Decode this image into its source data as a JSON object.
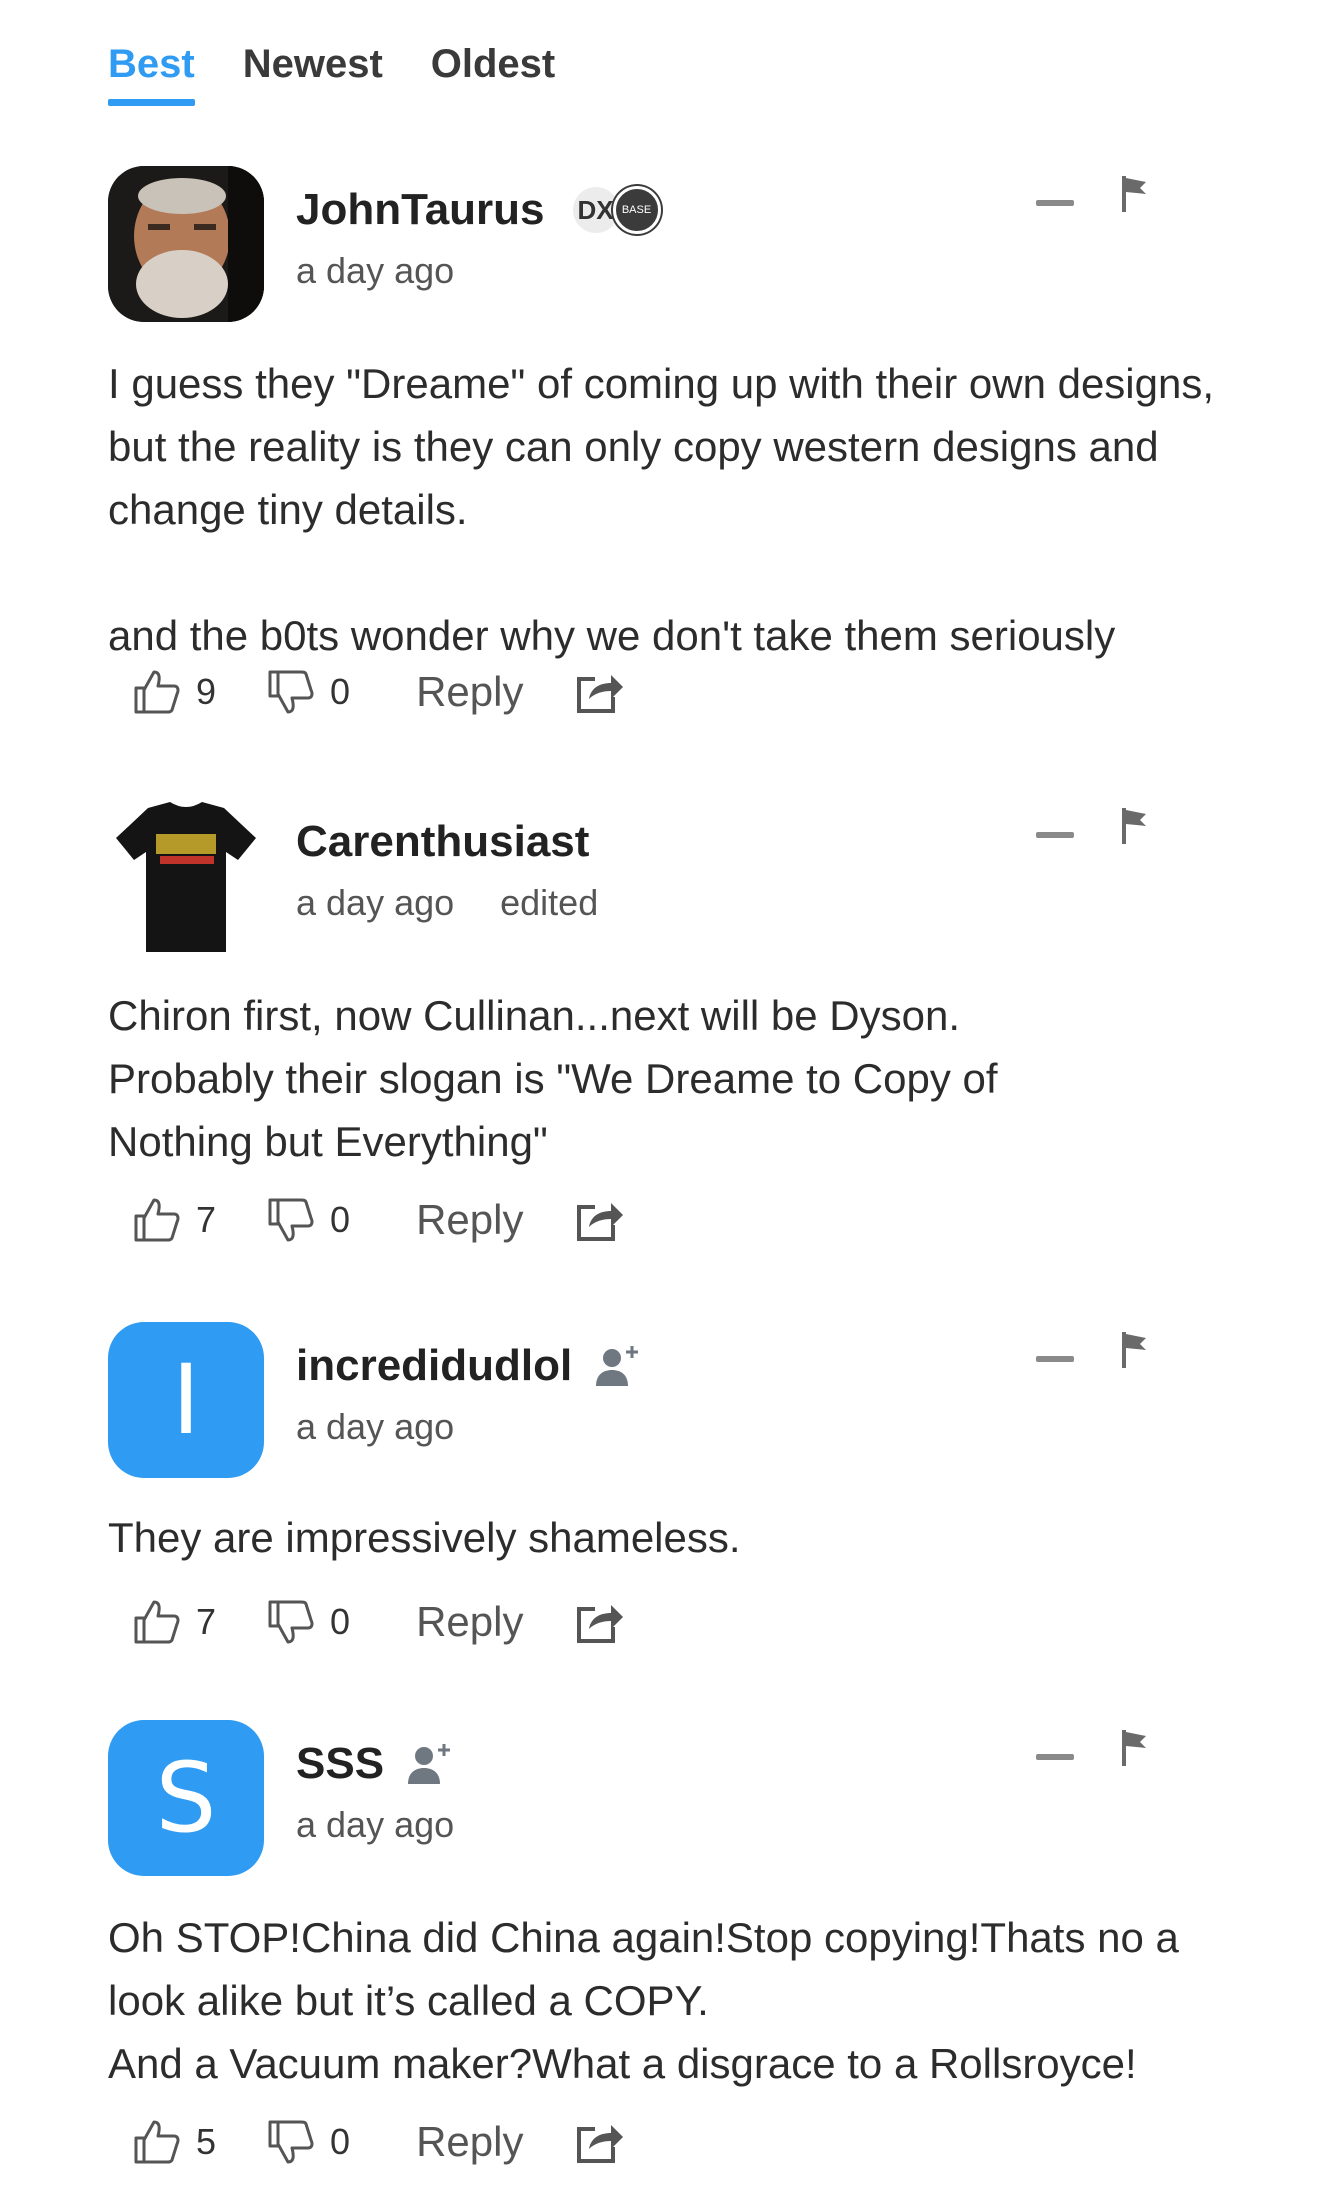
{
  "sort_tabs": [
    {
      "label": "Best",
      "active": true
    },
    {
      "label": "Newest",
      "active": false
    },
    {
      "label": "Oldest",
      "active": false
    }
  ],
  "reply_label": "Reply",
  "comments": [
    {
      "author": "JohnTaurus",
      "badges": [
        "DX",
        "BASE"
      ],
      "time": "a day ago",
      "edited": "",
      "avatar": "photo",
      "text": "I guess they \"Dreame\" of coming up with their own designs, but the reality is they can only copy western designs and change tiny details.\n\nand the b0ts wonder why we don't take them seriously",
      "likes": "9",
      "dislikes": "0"
    },
    {
      "author": "Carenthusiast",
      "time": "a day ago",
      "edited": "edited",
      "avatar": "shirt",
      "text": "Chiron first, now Cullinan...next will be Dyson.\nProbably their slogan is \"We Dreame to Copy of Nothing but Everything\"",
      "likes": "7",
      "dislikes": "0"
    },
    {
      "author": "incredidudlol",
      "time": "a day ago",
      "avatar_letter": "I",
      "text": "They are impressively shameless.",
      "likes": "7",
      "dislikes": "0"
    },
    {
      "author": "SSS",
      "time": "a day ago",
      "avatar_letter": "S",
      "text": "Oh STOP!China did China again!Stop copying!Thats no a look alike but it’s called a COPY.\nAnd a Vacuum maker?What a disgrace to a Rollsroyce!",
      "likes": "5",
      "dislikes": "0"
    }
  ],
  "colors": {
    "accent": "#2f9bf2",
    "avatar_bg": "#2f9bf2"
  },
  "icons": [
    "thumbs-up-icon",
    "thumbs-down-icon",
    "share-icon",
    "flag-icon",
    "collapse-icon",
    "follow-icon"
  ]
}
